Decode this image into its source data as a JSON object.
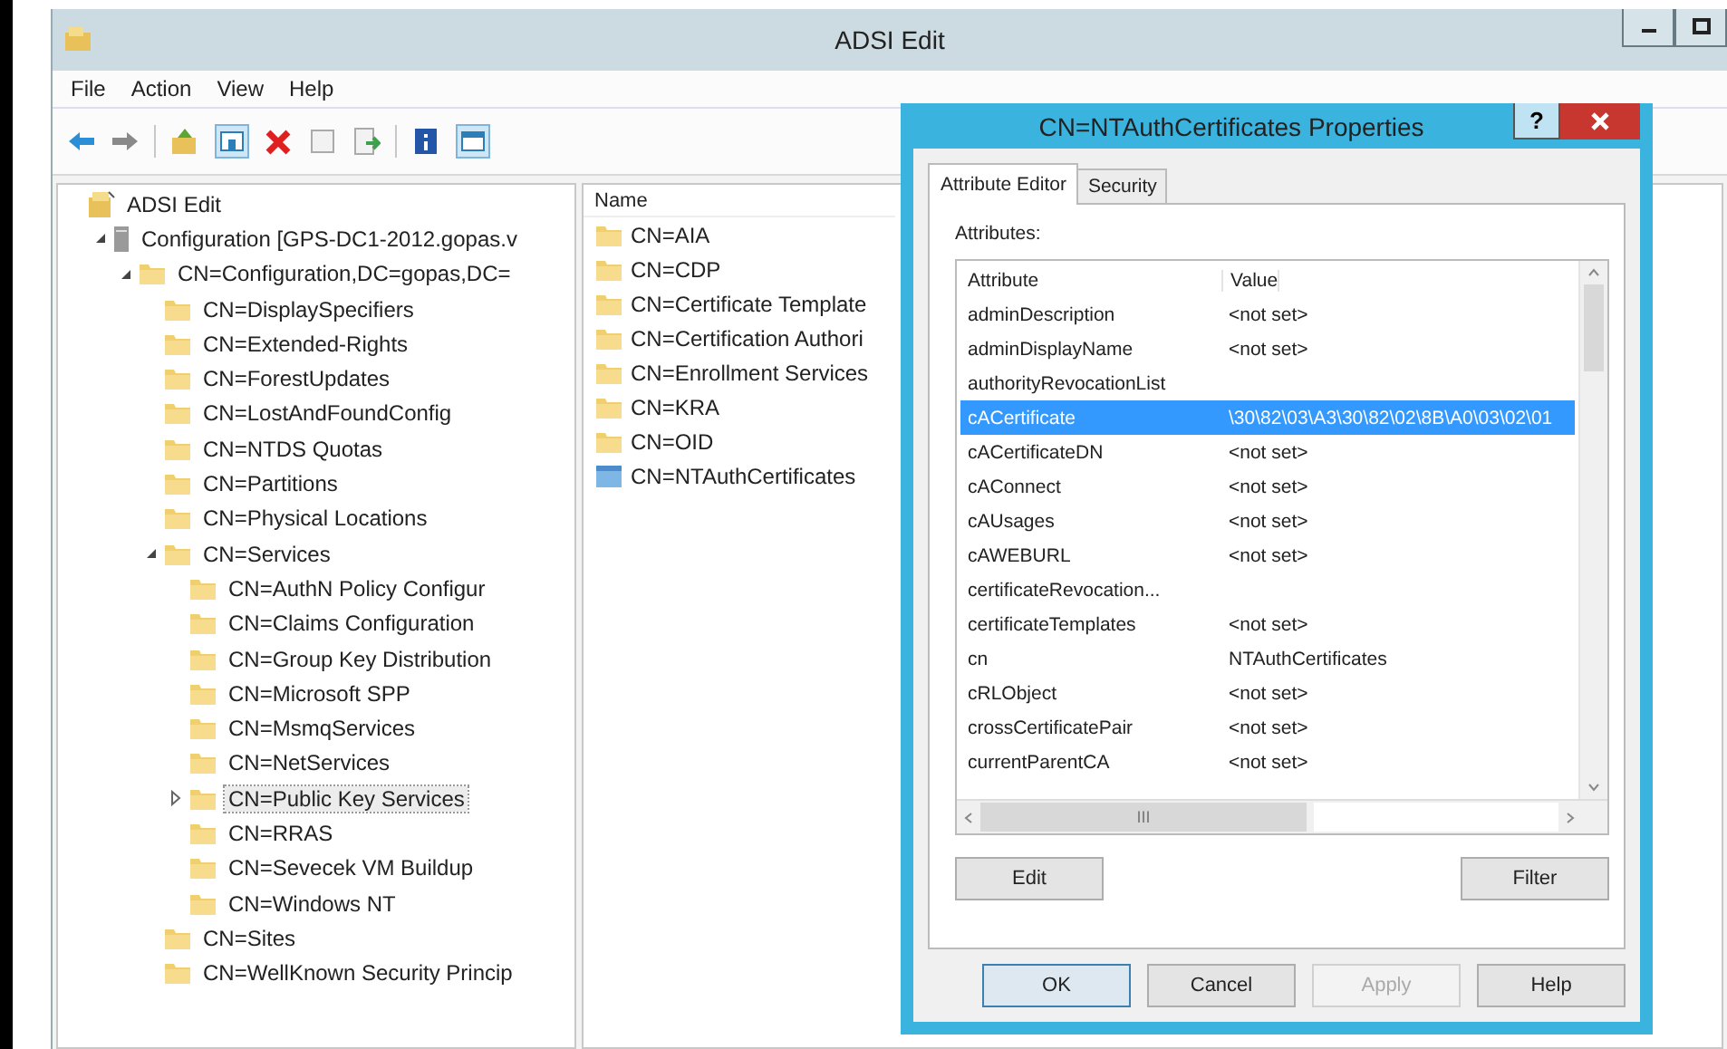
{
  "window": {
    "title": "ADSI Edit"
  },
  "menu": [
    "File",
    "Action",
    "View",
    "Help"
  ],
  "tree": [
    {
      "label": "ADSI Edit",
      "kind": "snapin",
      "selected": false,
      "children": [
        {
          "label": "Configuration [GPS-DC1-2012.gopas.v",
          "kind": "server",
          "expanded": true,
          "selected": false,
          "children": [
            {
              "label": "CN=Configuration,DC=gopas,DC=",
              "kind": "folder",
              "expanded": true,
              "selected": false,
              "children": [
                {
                  "label": "CN=DisplaySpecifiers",
                  "kind": "folder",
                  "selected": false
                },
                {
                  "label": "CN=Extended-Rights",
                  "kind": "folder",
                  "selected": false
                },
                {
                  "label": "CN=ForestUpdates",
                  "kind": "folder",
                  "selected": false
                },
                {
                  "label": "CN=LostAndFoundConfig",
                  "kind": "folder",
                  "selected": false
                },
                {
                  "label": "CN=NTDS Quotas",
                  "kind": "folder",
                  "selected": false
                },
                {
                  "label": "CN=Partitions",
                  "kind": "folder",
                  "selected": false
                },
                {
                  "label": "CN=Physical Locations",
                  "kind": "folder",
                  "selected": false
                },
                {
                  "label": "CN=Services",
                  "kind": "folder",
                  "expanded": true,
                  "selected": false,
                  "children": [
                    {
                      "label": "CN=AuthN Policy Configur",
                      "kind": "folder",
                      "selected": false
                    },
                    {
                      "label": "CN=Claims Configuration",
                      "kind": "folder",
                      "selected": false
                    },
                    {
                      "label": "CN=Group Key Distribution",
                      "kind": "folder",
                      "selected": false
                    },
                    {
                      "label": "CN=Microsoft SPP",
                      "kind": "folder",
                      "selected": false
                    },
                    {
                      "label": "CN=MsmqServices",
                      "kind": "folder",
                      "selected": false
                    },
                    {
                      "label": "CN=NetServices",
                      "kind": "folder",
                      "selected": false
                    },
                    {
                      "label": "CN=Public Key Services",
                      "kind": "folder",
                      "expanded": false,
                      "selected": true
                    },
                    {
                      "label": "CN=RRAS",
                      "kind": "folder",
                      "selected": false
                    },
                    {
                      "label": "CN=Sevecek VM Buildup",
                      "kind": "folder",
                      "selected": false
                    },
                    {
                      "label": "CN=Windows NT",
                      "kind": "folder",
                      "selected": false
                    }
                  ]
                },
                {
                  "label": "CN=Sites",
                  "kind": "folder",
                  "selected": false
                },
                {
                  "label": "CN=WellKnown Security Princip",
                  "kind": "folder",
                  "selected": false
                }
              ]
            }
          ]
        }
      ]
    }
  ],
  "list": {
    "header": "Name",
    "items": [
      {
        "label": "CN=AIA",
        "kind": "folder"
      },
      {
        "label": "CN=CDP",
        "kind": "folder"
      },
      {
        "label": "CN=Certificate Template",
        "kind": "folder"
      },
      {
        "label": "CN=Certification Authori",
        "kind": "folder"
      },
      {
        "label": "CN=Enrollment Services",
        "kind": "folder"
      },
      {
        "label": "CN=KRA",
        "kind": "folder"
      },
      {
        "label": "CN=OID",
        "kind": "folder"
      },
      {
        "label": "CN=NTAuthCertificates",
        "kind": "object"
      }
    ]
  },
  "dialog": {
    "title": "CN=NTAuthCertificates Properties",
    "help": "?",
    "tabs": [
      {
        "label": "Attribute Editor",
        "selected": true
      },
      {
        "label": "Security",
        "selected": false
      }
    ],
    "attributes_label": "Attributes:",
    "columns": [
      "Attribute",
      "Value"
    ],
    "rows": [
      {
        "attribute": "adminDescription",
        "value": "<not set>",
        "selected": false
      },
      {
        "attribute": "adminDisplayName",
        "value": "<not set>",
        "selected": false
      },
      {
        "attribute": "authorityRevocationList",
        "selected": false
      },
      {
        "attribute": "cACertificate",
        "value": "\\30\\82\\03\\A3\\30\\82\\02\\8B\\A0\\03\\02\\01",
        "selected": true
      },
      {
        "attribute": "cACertificateDN",
        "value": "<not set>",
        "selected": false
      },
      {
        "attribute": "cAConnect",
        "value": "<not set>",
        "selected": false
      },
      {
        "attribute": "cAUsages",
        "value": "<not set>",
        "selected": false
      },
      {
        "attribute": "cAWEBURL",
        "value": "<not set>",
        "selected": false
      },
      {
        "attribute": "certificateRevocation...",
        "selected": false
      },
      {
        "attribute": "certificateTemplates",
        "value": "<not set>",
        "selected": false
      },
      {
        "attribute": "cn",
        "value": "NTAuthCertificates",
        "selected": false
      },
      {
        "attribute": "cRLObject",
        "value": "<not set>",
        "selected": false
      },
      {
        "attribute": "crossCertificatePair",
        "value": "<not set>",
        "selected": false
      },
      {
        "attribute": "currentParentCA",
        "value": "<not set>",
        "selected": false
      }
    ],
    "hscroll_grip": "III",
    "edit_button": "Edit",
    "filter_button": "Filter",
    "buttons": [
      {
        "label": "OK",
        "disabled": false,
        "default": true
      },
      {
        "label": "Cancel",
        "disabled": false,
        "default": false
      },
      {
        "label": "Apply",
        "disabled": true,
        "default": false
      },
      {
        "label": "Help",
        "disabled": false,
        "default": false
      }
    ]
  }
}
